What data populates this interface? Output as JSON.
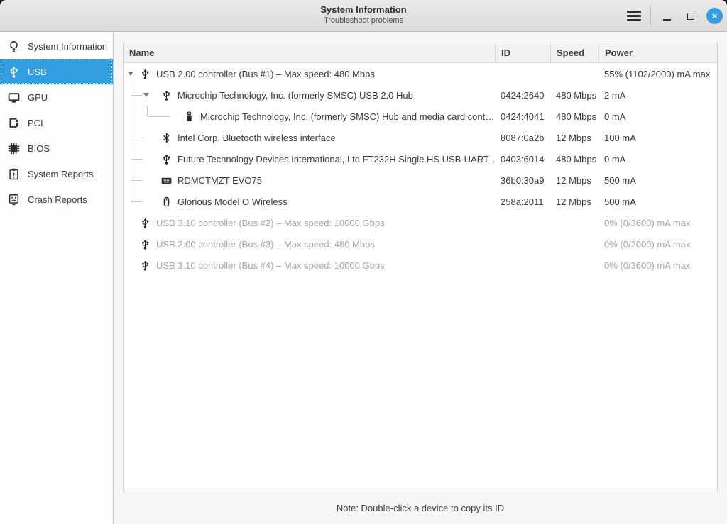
{
  "window": {
    "title": "System Information",
    "subtitle": "Troubleshoot problems"
  },
  "titlebar": {
    "close_glyph": "×"
  },
  "colors": {
    "accent_blue": "#339fe2",
    "muted_text": "#a6a5a3",
    "selected_text": "#ffffff"
  },
  "sidebar": {
    "items": [
      {
        "label": "System Information",
        "icon": "lightbulb-icon",
        "selected": false
      },
      {
        "label": "USB",
        "icon": "usb-icon",
        "selected": true
      },
      {
        "label": "GPU",
        "icon": "monitor-icon",
        "selected": false
      },
      {
        "label": "PCI",
        "icon": "pci-card-icon",
        "selected": false
      },
      {
        "label": "BIOS",
        "icon": "chip-icon",
        "selected": false
      },
      {
        "label": "System Reports",
        "icon": "clipboard-report-icon",
        "selected": false
      },
      {
        "label": "Crash Reports",
        "icon": "crash-face-icon",
        "selected": false
      }
    ]
  },
  "table": {
    "columns": [
      "Name",
      "ID",
      "Speed",
      "Power"
    ],
    "rows": [
      {
        "name": "USB 2.00 controller (Bus #1) – Max speed: 480 Mbps",
        "id": "",
        "speed": "",
        "power": "55% (1102/2000) mA max",
        "icon": "usb-icon",
        "level": 0,
        "expanded": true,
        "muted": false,
        "tree": ""
      },
      {
        "name": "Microchip Technology, Inc. (formerly SMSC) USB 2.0 Hub",
        "id": "0424:2640",
        "speed": "480 Mbps",
        "power": "2 mA",
        "icon": "usb-icon",
        "level": 1,
        "expanded": true,
        "muted": false,
        "tree": "child"
      },
      {
        "name": "Microchip Technology, Inc. (formerly SMSC) Hub and media card cont…",
        "id": "0424:4041",
        "speed": "480 Mbps",
        "power": "0 mA",
        "icon": "usb-stick-icon",
        "level": 2,
        "expanded": false,
        "muted": false,
        "tree": "grandchild"
      },
      {
        "name": "Intel Corp. Bluetooth wireless interface",
        "id": "8087:0a2b",
        "speed": "12 Mbps",
        "power": "100 mA",
        "icon": "bluetooth-icon",
        "level": 1,
        "expanded": false,
        "muted": false,
        "tree": "child"
      },
      {
        "name": "Future Technology Devices International, Ltd FT232H Single HS USB-UART…",
        "id": "0403:6014",
        "speed": "480 Mbps",
        "power": "0 mA",
        "icon": "usb-icon",
        "level": 1,
        "expanded": false,
        "muted": false,
        "tree": "child"
      },
      {
        "name": "RDMCTMZT EVO75",
        "id": "36b0:30a9",
        "speed": "12 Mbps",
        "power": "500 mA",
        "icon": "keyboard-icon",
        "level": 1,
        "expanded": false,
        "muted": false,
        "tree": "child"
      },
      {
        "name": "Glorious Model O Wireless",
        "id": "258a:2011",
        "speed": "12 Mbps",
        "power": "500 mA",
        "icon": "mouse-icon",
        "level": 1,
        "expanded": false,
        "muted": false,
        "tree": "child-last"
      },
      {
        "name": "USB 3.10 controller (Bus #2) – Max speed: 10000 Gbps",
        "id": "",
        "speed": "",
        "power": "0% (0/3600) mA max",
        "icon": "usb-icon",
        "level": 0,
        "expanded": false,
        "muted": true,
        "tree": ""
      },
      {
        "name": "USB 2.00 controller (Bus #3) – Max speed: 480 Mbps",
        "id": "",
        "speed": "",
        "power": "0% (0/2000) mA max",
        "icon": "usb-icon",
        "level": 0,
        "expanded": false,
        "muted": true,
        "tree": ""
      },
      {
        "name": "USB 3.10 controller (Bus #4) – Max speed: 10000 Gbps",
        "id": "",
        "speed": "",
        "power": "0% (0/3600) mA max",
        "icon": "usb-icon",
        "level": 0,
        "expanded": false,
        "muted": true,
        "tree": ""
      }
    ]
  },
  "footer": {
    "note": "Note: Double-click a device to copy its ID"
  }
}
